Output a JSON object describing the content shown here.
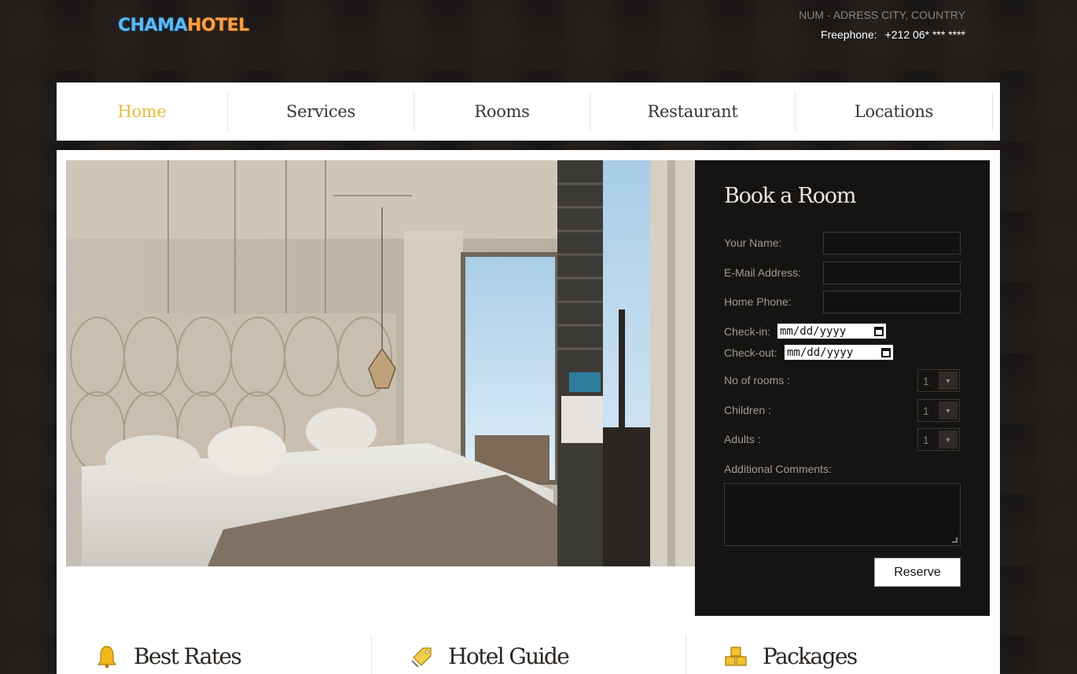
{
  "header": {
    "logo_part1": "CHAMA",
    "logo_part2": "HOTEL",
    "address": "NUM - ADRESS CITY, COUNTRY",
    "phone_label": "Freephone:",
    "phone_number": "+212 06* *** ****"
  },
  "nav": {
    "items": [
      {
        "label": "Home",
        "active": true
      },
      {
        "label": "Services"
      },
      {
        "label": "Rooms"
      },
      {
        "label": "Restaurant"
      },
      {
        "label": "Locations"
      }
    ]
  },
  "booking": {
    "title": "Book a Room",
    "name_label": "Your Name:",
    "email_label": "E-Mail Address:",
    "phone_label": "Home Phone:",
    "checkin_label": "Check-in:",
    "checkin_value": "mm/dd/yyyy",
    "checkout_label": "Check-out:",
    "checkout_value": "mm/dd/yyyy",
    "rooms_label": "No of rooms :",
    "rooms_value": "1",
    "children_label": "Children :",
    "children_value": "1",
    "adults_label": "Adults :",
    "adults_value": "1",
    "comments_label": "Additional Comments:",
    "reserve_label": "Reserve"
  },
  "features": [
    {
      "label": "Best Rates",
      "icon": "bell-icon"
    },
    {
      "label": "Hotel Guide",
      "icon": "tag-icon"
    },
    {
      "label": "Packages",
      "icon": "cubes-icon"
    }
  ],
  "colors": {
    "accent": "#e8b93a",
    "background": "#1f1c1a",
    "panel": "#161412"
  }
}
